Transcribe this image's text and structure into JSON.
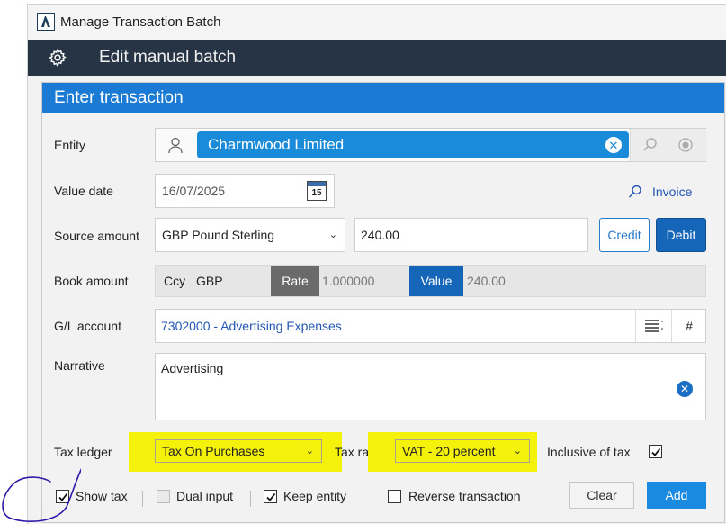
{
  "window": {
    "title": "Manage Transaction Batch"
  },
  "header": {
    "title": "Edit manual batch"
  },
  "panel": {
    "title": "Enter transaction"
  },
  "entity": {
    "label": "Entity",
    "value": "Charmwood Limited"
  },
  "value_date": {
    "label": "Value date",
    "value": "16/07/2025",
    "calendar_day": "15"
  },
  "invoice": {
    "label": "Invoice"
  },
  "source_amount": {
    "label": "Source amount",
    "currency": "GBP Pound Sterling",
    "amount": "240.00",
    "credit_label": "Credit",
    "debit_label": "Debit"
  },
  "book_amount": {
    "label": "Book amount",
    "ccy_label": "Ccy",
    "ccy_value": "GBP",
    "rate_label": "Rate",
    "rate_value": "1.000000",
    "value_label": "Value",
    "value_value": "240.00"
  },
  "gl_account": {
    "label": "G/L account",
    "value": "7302000 - Advertising Expenses",
    "hash_label": "#"
  },
  "narrative": {
    "label": "Narrative",
    "value": "Advertising"
  },
  "tax": {
    "ledger_label": "Tax ledger",
    "ledger_value": "Tax On Purchases",
    "rate_label": "Tax rate",
    "rate_value": "VAT - 20 percent",
    "inclusive_label": "Inclusive of tax",
    "inclusive_checked": true
  },
  "options": {
    "show_tax": {
      "label": "Show tax",
      "checked": true
    },
    "dual_input": {
      "label": "Dual input",
      "checked": false
    },
    "keep_entity": {
      "label": "Keep entity",
      "checked": true
    },
    "reverse_transaction": {
      "label": "Reverse transaction",
      "checked": false
    }
  },
  "buttons": {
    "clear": "Clear",
    "add": "Add"
  },
  "colors": {
    "header_bg": "#263445",
    "panel_head": "#1a7ad4",
    "entity_chip": "#1a8bd9",
    "highlight": "#f4f10a",
    "debit": "#1565b8",
    "add": "#1a8ae0"
  },
  "icons": [
    "app-logo-icon",
    "gear-icon",
    "person-icon",
    "clear-icon",
    "search-icon",
    "radio-icon",
    "calendar-icon",
    "list-icon",
    "chevron-down-icon",
    "checkbox-checked-icon"
  ]
}
